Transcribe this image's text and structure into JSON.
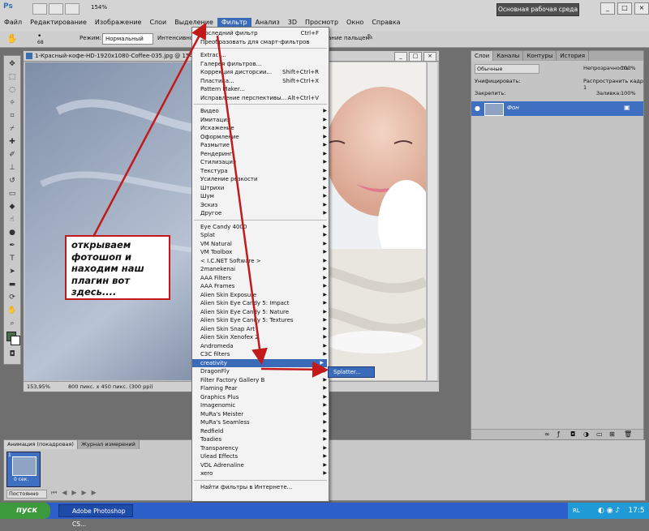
{
  "app": {
    "logo": "Ps",
    "zoom": "154%",
    "workspace_label": "Основная рабочая среда"
  },
  "menus": [
    "Файл",
    "Редактирование",
    "Изображение",
    "Слои",
    "Выделение",
    "Фильтр",
    "Анализ",
    "3D",
    "Просмотр",
    "Окно",
    "Справка"
  ],
  "options_bar": {
    "brush_size": "68",
    "mode_label": "Режим:",
    "mode_value": "Нормальный",
    "intensity_label": "Интенсивность:",
    "finger_label": "ание пальцем"
  },
  "document": {
    "title": "1-Красный-кофе-HD-1920x1080-Coffee-035.jpg @ 154",
    "zoom_status": "153,95%",
    "size_status": "800 пикс. x 450 пикс. (300 ppi)"
  },
  "layers_panel": {
    "tabs": [
      "Слои",
      "Каналы",
      "Контуры",
      "История"
    ],
    "blend_mode": "Обычные",
    "opacity_label": "Непрозрачность:",
    "opacity_value": "100%",
    "unify_label": "Унифицировать:",
    "propagate_label": "Распространить кадр 1",
    "lock_label": "Закрепить:",
    "fill_label": "Заливка:",
    "fill_value": "100%",
    "layer_name": "Фон"
  },
  "animation_panel": {
    "tabs": [
      "Анимация (покадровая)",
      "Журнал измерений"
    ],
    "frame_time": "0 сек.",
    "loop": "Постоянно"
  },
  "filter_menu": {
    "top": [
      {
        "label": "Последний фильтр",
        "shortcut": "Ctrl+F"
      },
      {
        "label": "Преобразовать для смарт-фильтров",
        "shortcut": ""
      }
    ],
    "special": [
      {
        "label": "Extract...",
        "shortcut": ""
      },
      {
        "label": "Галерея фильтров...",
        "shortcut": ""
      },
      {
        "label": "Коррекция дисторсии...",
        "shortcut": "Shift+Ctrl+R"
      },
      {
        "label": "Пластика...",
        "shortcut": "Shift+Ctrl+X"
      },
      {
        "label": "Pattern Maker...",
        "shortcut": ""
      },
      {
        "label": "Исправление перспективы...",
        "shortcut": "Alt+Ctrl+V"
      }
    ],
    "groups": [
      "Видео",
      "Имитация",
      "Искажение",
      "Оформление",
      "Размытие",
      "Рендеринг",
      "Стилизация",
      "Текстура",
      "Усиление резкости",
      "Штрихи",
      "Шум",
      "Эскиз",
      "Другое"
    ],
    "plugins": [
      "Eye Candy 4000",
      "Splat",
      "VM Natural",
      "VM Toolbox",
      "< I.C.NET Software >",
      "2manekenai",
      "AAA Filters",
      "AAA Frames",
      "Alien Skin Exposure",
      "Alien Skin Eye Candy 5: Impact",
      "Alien Skin Eye Candy 5: Nature",
      "Alien Skin Eye Candy 5: Textures",
      "Alien Skin Snap Art",
      "Alien Skin Xenofex 2",
      "Andromeda",
      "C3C filters",
      "creativity",
      "DragonFly",
      "Filter Factory Gallery B",
      "Flaming Pear",
      "Graphics Plus",
      "Imagenomic",
      "MuRa's Meister",
      "MuRa's Seamless",
      "Redfield",
      "Toadies",
      "Transparency",
      "Ulead Effects",
      "VDL Adrenaline",
      "xero"
    ],
    "online": "Найти фильтры в Интернете...",
    "highlighted": "creativity",
    "submenu_item": "Splatter..."
  },
  "annotation": "открываем фотошоп и находим наш плагин вот здесь....",
  "taskbar": {
    "start": "пуск",
    "task": "Adobe Photoshop CS...",
    "lang": "RL",
    "time": "17:5"
  },
  "colors": {
    "accent": "#3b6bb8",
    "annotation_border": "#c21a1a",
    "arrow": "#c21a1a"
  }
}
